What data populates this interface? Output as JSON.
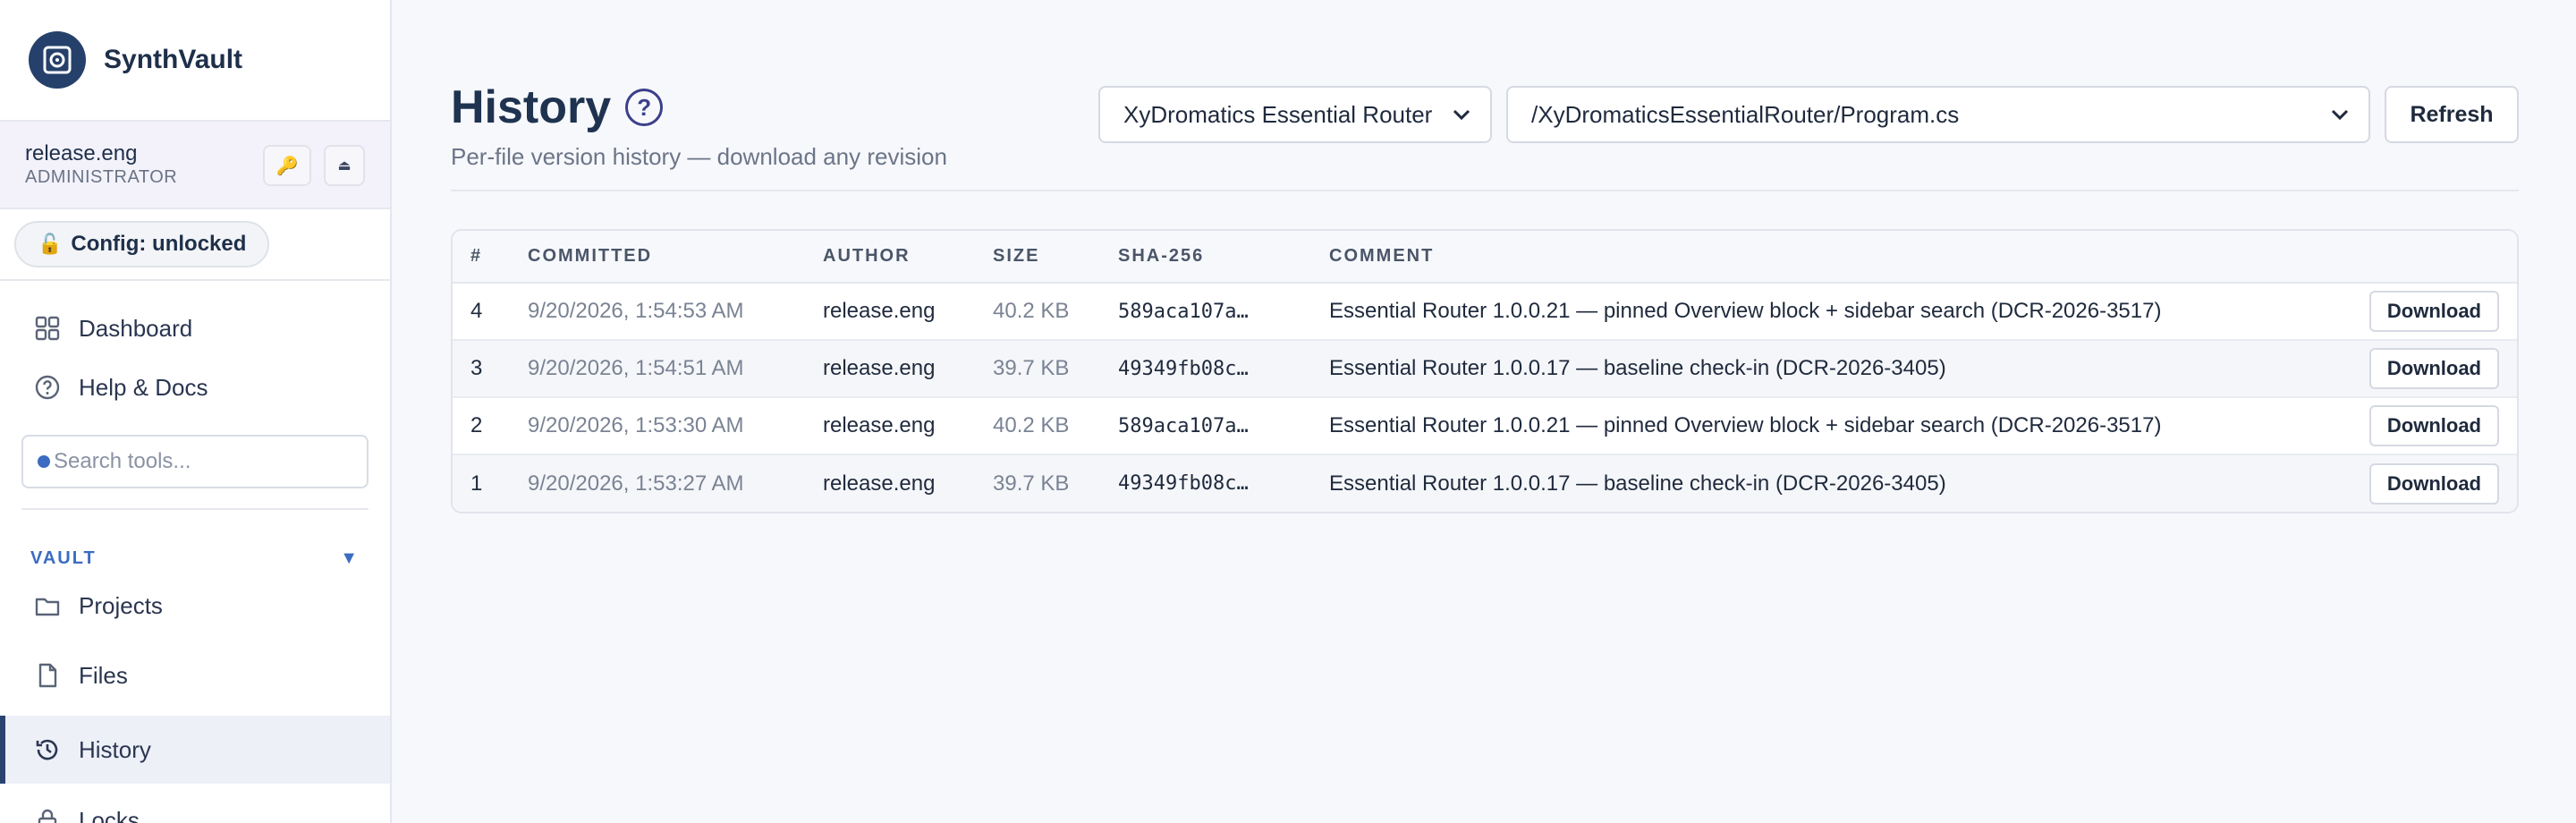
{
  "brand": {
    "name": "SynthVault"
  },
  "user": {
    "name": "release.eng",
    "role": "ADMINISTRATOR"
  },
  "config": {
    "label": "Config: unlocked"
  },
  "nav_top": [
    {
      "label": "Dashboard",
      "icon": "grid-icon"
    },
    {
      "label": "Help & Docs",
      "icon": "help-circle-icon"
    }
  ],
  "search": {
    "placeholder": "Search tools..."
  },
  "section": {
    "label": "VAULT"
  },
  "nav_vault": [
    {
      "label": "Projects",
      "icon": "folder-icon"
    },
    {
      "label": "Files",
      "icon": "file-icon"
    },
    {
      "label": "History",
      "icon": "history-icon",
      "active": true
    },
    {
      "label": "Locks",
      "icon": "lock-icon"
    }
  ],
  "page": {
    "title": "History",
    "subtitle": "Per-file version history — download any revision"
  },
  "filters": {
    "project": "XyDromatics Essential Router",
    "file": "/XyDromaticsEssentialRouter/Program.cs",
    "refresh_label": "Refresh"
  },
  "table": {
    "headers": [
      "#",
      "COMMITTED",
      "AUTHOR",
      "SIZE",
      "SHA-256",
      "COMMENT"
    ],
    "download_label": "Download",
    "rows": [
      {
        "num": "4",
        "committed": "9/20/2026, 1:54:53 AM",
        "author": "release.eng",
        "size": "40.2 KB",
        "sha": "589aca107a…",
        "comment": "Essential Router 1.0.0.21 — pinned Overview block + sidebar search (DCR-2026-3517)"
      },
      {
        "num": "3",
        "committed": "9/20/2026, 1:54:51 AM",
        "author": "release.eng",
        "size": "39.7 KB",
        "sha": "49349fb08c…",
        "comment": "Essential Router 1.0.0.17 — baseline check-in (DCR-2026-3405)"
      },
      {
        "num": "2",
        "committed": "9/20/2026, 1:53:30 AM",
        "author": "release.eng",
        "size": "40.2 KB",
        "sha": "589aca107a…",
        "comment": "Essential Router 1.0.0.21 — pinned Overview block + sidebar search (DCR-2026-3517)"
      },
      {
        "num": "1",
        "committed": "9/20/2026, 1:53:27 AM",
        "author": "release.eng",
        "size": "39.7 KB",
        "sha": "49349fb08c…",
        "comment": "Essential Router 1.0.0.17 — baseline check-in (DCR-2026-3405)"
      }
    ]
  }
}
